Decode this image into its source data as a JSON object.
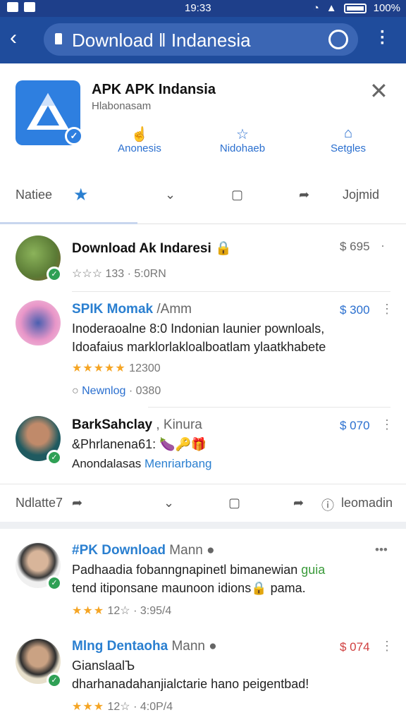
{
  "status_bar": {
    "time": "19:33",
    "battery": "100%"
  },
  "browser": {
    "url_text": "Download ‖ Indanesia"
  },
  "app": {
    "title": "APK APK Indansia",
    "subtitle": "Hlabonasam",
    "quick_actions": [
      {
        "label": "Anonesis",
        "icon": "hand-icon"
      },
      {
        "label": "Nidohaeb",
        "icon": "star-outline-icon"
      },
      {
        "label": "Setgles",
        "icon": "home-icon"
      }
    ]
  },
  "tabs": {
    "first": "Natiee",
    "last": "Jojmid"
  },
  "posts": [
    {
      "name": "Download Ak Indaresi",
      "emoji": "🔒",
      "price": "$ 695",
      "meta": "☆☆☆ 133 · 5:0RN"
    },
    {
      "name": "SPIK Momak",
      "name_suffix": "/Amm",
      "price": "$ 300",
      "line1": "Inoderaoalne 8:0 Indonian launier pownloals,",
      "line2": "Idoafaius marklorlakloalboatlam ylaatkhabete",
      "stars": "★★★★★",
      "meta": "12300",
      "footer_label": "Newnlog",
      "footer_meta": "· 0380"
    },
    {
      "name": "BarkSahclay",
      "name_suffix": ", Kinura",
      "price": "$ 070",
      "line1": "&Phrlanena61: 🍆🔑🎁",
      "line2_prefix": "Anondalasas ",
      "line2_link": "Menriarbang"
    }
  ],
  "action_bar": {
    "left": "Ndlatte7",
    "right": "leomadin"
  },
  "posts2": [
    {
      "name": "#PK Download",
      "name_suffix": " Mann",
      "price": "•••",
      "line1": "Padhaadia fobanngnapinetl bimanewian",
      "line1_highlight": "guia",
      "line2": "tend itiponsane maunoon idions🔒 pama.",
      "stars": "★★★",
      "meta": "12☆ · 3:95/4"
    },
    {
      "name": "Mlng Dentaoha",
      "name_suffix": " Mann",
      "price": "$ 074",
      "line1": "GianslaalЪ",
      "line2": "dharhanadahanjialctarie hano peigentbad!",
      "stars": "★★★",
      "meta": "12☆ · 4:0P/4"
    }
  ],
  "colors": {
    "header": "#1f4c9c",
    "accent": "#2a6fcf",
    "star": "#f5a524"
  }
}
